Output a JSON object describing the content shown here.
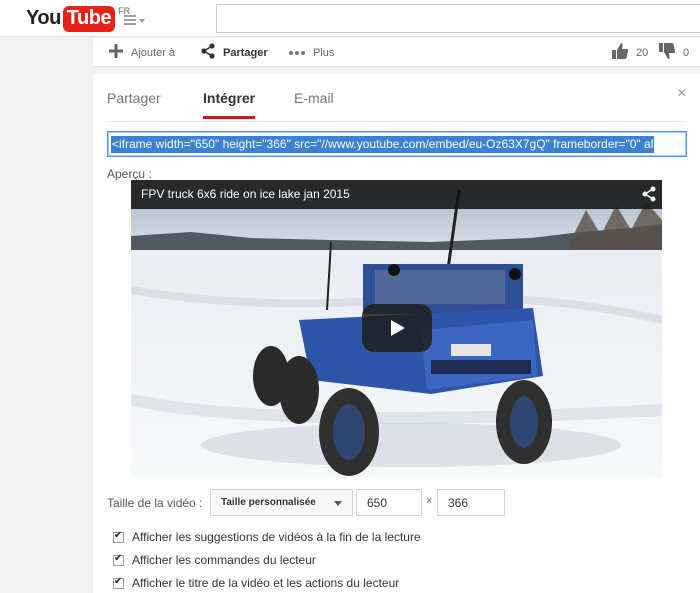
{
  "logo": {
    "you": "You",
    "tube": "Tube",
    "region": "FR"
  },
  "actions": {
    "add": "Ajouter à",
    "share": "Partager",
    "more": "Plus",
    "likes": "20",
    "dislikes": "0"
  },
  "share_panel": {
    "tabs": [
      {
        "label": "Partager",
        "active": false
      },
      {
        "label": "Intégrer",
        "active": true
      },
      {
        "label": "E-mail",
        "active": false
      }
    ],
    "close": "×",
    "embed_code": "<iframe width=\"650\" height=\"366\" src=\"//www.youtube.com/embed/eu-Oz63X7gQ\" frameborder=\"0\" al",
    "preview_label": "Aperçu :",
    "video": {
      "title": "FPV truck 6x6 ride on ice lake jan 2015"
    },
    "size": {
      "label": "Taille de la vidéo :",
      "selected": "Taille personnalisée",
      "width": "650",
      "times": "×",
      "height": "366"
    },
    "options": [
      {
        "label": "Afficher les suggestions de vidéos à la fin de la lecture",
        "checked": true
      },
      {
        "label": "Afficher les commandes du lecteur",
        "checked": true
      },
      {
        "label": "Afficher le titre de la vidéo et les actions du lecteur",
        "checked": true
      }
    ]
  },
  "colors": {
    "brand": "#e62117",
    "tab_accent": "#cc181e",
    "selection": "#3b82d4"
  }
}
